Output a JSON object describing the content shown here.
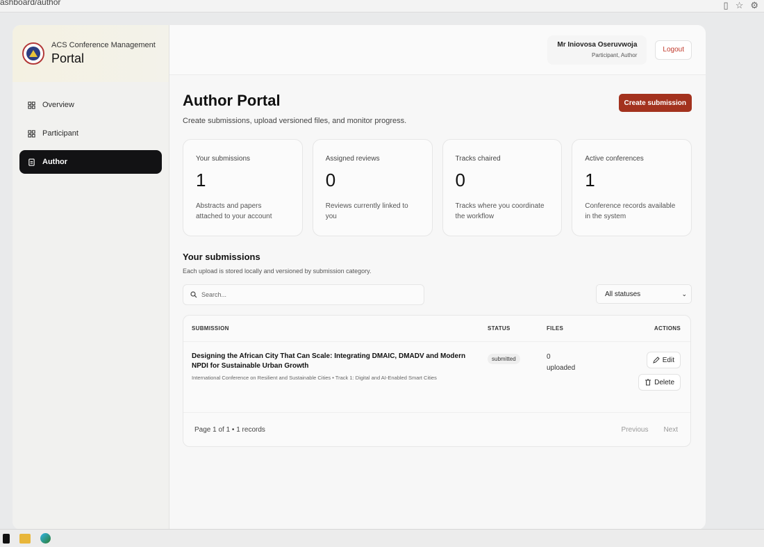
{
  "browser": {
    "url_fragment": "ashboard/author",
    "icons": [
      "reader-icon",
      "star-icon",
      "extensions-icon"
    ]
  },
  "brand": {
    "subtitle": "ACS Conference Management",
    "title": "Portal"
  },
  "sidebar": {
    "items": [
      {
        "label": "Overview",
        "icon": "grid-icon",
        "active": false
      },
      {
        "label": "Participant",
        "icon": "grid-icon",
        "active": false
      },
      {
        "label": "Author",
        "icon": "document-icon",
        "active": true
      }
    ]
  },
  "header": {
    "user_name": "Mr Iniovosa Oseruvwoja",
    "user_role": "Participant, Author",
    "logout_label": "Logout"
  },
  "page": {
    "title": "Author Portal",
    "description": "Create submissions, upload versioned files, and monitor progress.",
    "create_label": "Create submission"
  },
  "stats": [
    {
      "label": "Your submissions",
      "value": "1",
      "desc": "Abstracts and papers attached to your account"
    },
    {
      "label": "Assigned reviews",
      "value": "0",
      "desc": "Reviews currently linked to you"
    },
    {
      "label": "Tracks chaired",
      "value": "0",
      "desc": "Tracks where you coordinate the workflow"
    },
    {
      "label": "Active conferences",
      "value": "1",
      "desc": "Conference records available in the system"
    }
  ],
  "submissions": {
    "title": "Your submissions",
    "description": "Each upload is stored locally and versioned by submission category.",
    "search_placeholder": "Search...",
    "status_filter": "All statuses",
    "columns": {
      "submission": "SUBMISSION",
      "status": "STATUS",
      "files": "FILES",
      "actions": "ACTIONS"
    },
    "rows": [
      {
        "title": "Designing the African City That Can Scale: Integrating DMAIC, DMADV and Modern NPDI for Sustainable Urban Growth",
        "meta": "International Conference on Resilient and Sustainable Cities • Track 1: Digital and AI-Enabled Smart Cities",
        "status": "submitted",
        "files_count": "0",
        "files_label": "uploaded",
        "edit_label": "Edit",
        "delete_label": "Delete"
      }
    ],
    "page_info": "Page 1 of 1 • 1 records",
    "prev_label": "Previous",
    "next_label": "Next"
  },
  "colors": {
    "accent": "#a3321e",
    "active_nav": "#121214",
    "logout": "#c0392b"
  }
}
